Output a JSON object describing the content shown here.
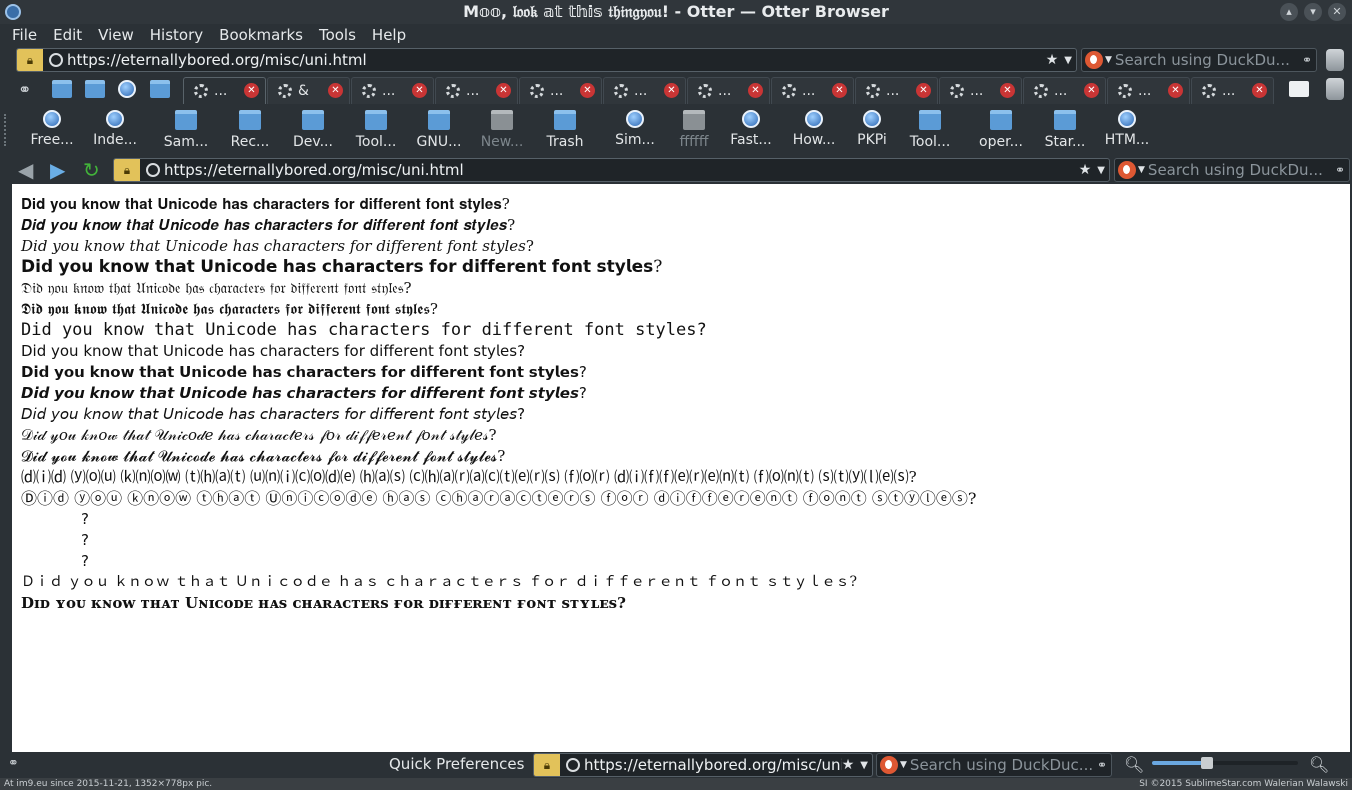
{
  "window": {
    "title": "M𝕠𝕠, 𝔩𝔬𝔬𝔨 𝕒𝕥 𝕥𝕙𝕚𝕤 𝔱𝔥𝔦𝔫𝔤𝔶𝔬𝔲! - Otter — Otter Browser",
    "controls": [
      "▴",
      "▾",
      "✕"
    ]
  },
  "menu": [
    "File",
    "Edit",
    "View",
    "History",
    "Bookmarks",
    "Tools",
    "Help"
  ],
  "address": {
    "url": "https://eternallybored.org/misc/uni.html"
  },
  "search": {
    "placeholder": "Search using DuckDu..."
  },
  "tabs": [
    {
      "label": "...",
      "active": true
    },
    {
      "label": "&"
    },
    {
      "label": "..."
    },
    {
      "label": "..."
    },
    {
      "label": "..."
    },
    {
      "label": "..."
    },
    {
      "label": "..."
    },
    {
      "label": "..."
    },
    {
      "label": "..."
    },
    {
      "label": "..."
    },
    {
      "label": "..."
    },
    {
      "label": "..."
    },
    {
      "label": "..."
    }
  ],
  "bookmarks": [
    {
      "label": "Free...",
      "icon": "web-icon"
    },
    {
      "label": "Inde...",
      "icon": "web-icon"
    },
    {
      "label": "Sam...",
      "icon": "folder-icon"
    },
    {
      "label": "Rec...",
      "icon": "folder-icon"
    },
    {
      "label": "Dev...",
      "icon": "folder-icon"
    },
    {
      "label": "Tool...",
      "icon": "folder-icon"
    },
    {
      "label": "GNU...",
      "icon": "folder-icon"
    },
    {
      "label": "New...",
      "icon": "folder-grey-icon"
    },
    {
      "label": "Trash",
      "icon": "folder-icon"
    },
    {
      "label": "Sim...",
      "icon": "web-icon"
    },
    {
      "label": "ffffff",
      "icon": "folder-grey-icon"
    },
    {
      "label": "Fast...",
      "icon": "web-icon"
    },
    {
      "label": "How...",
      "icon": "web-icon"
    },
    {
      "label": "PKPi",
      "icon": "web-icon"
    },
    {
      "label": "Tool...",
      "icon": "folder-icon"
    },
    {
      "label": "oper...",
      "icon": "folder-icon"
    },
    {
      "label": "Star...",
      "icon": "folder-icon"
    },
    {
      "label": "HTM...",
      "icon": "web-icon"
    }
  ],
  "page": {
    "lines": [
      "𝐃𝐢𝐝 𝐲𝐨𝐮 𝐤𝐧𝐨𝐰 𝐭𝐡𝐚𝐭 𝐔𝐧𝐢𝐜𝐨𝐝𝐞 𝐡𝐚𝐬 𝐜𝐡𝐚𝐫𝐚𝐜𝐭𝐞𝐫𝐬 𝐟𝐨𝐫 𝐝𝐢𝐟𝐟𝐞𝐫𝐞𝐧𝐭 𝐟𝐨𝐧𝐭 𝐬𝐭𝐲𝐥𝐞𝐬?",
      "𝑫𝒊𝒅 𝒚𝒐𝒖 𝒌𝒏𝒐𝒘 𝒕𝒉𝒂𝒕 𝑼𝒏𝒊𝒄𝒐𝒅𝒆 𝒉𝒂𝒔 𝒄𝒉𝒂𝒓𝒂𝒄𝒕𝒆𝒓𝒔 𝒇𝒐𝒓 𝒅𝒊𝒇𝒇𝒆𝒓𝒆𝒏𝒕 𝒇𝒐𝒏𝒕 𝒔𝒕𝒚𝒍𝒆𝒔?",
      "𝐷𝑖𝑑 𝑦𝑜𝑢 𝑘𝑛𝑜𝑤 𝑡ℎ𝑎𝑡 𝑈𝑛𝑖𝑐𝑜𝑑𝑒 ℎ𝑎𝑠 𝑐ℎ𝑎𝑟𝑎𝑐𝑡𝑒𝑟𝑠 𝑓𝑜𝑟 𝑑𝑖𝑓𝑓𝑒𝑟𝑒𝑛𝑡 𝑓𝑜𝑛𝑡 𝑠𝑡𝑦𝑙𝑒𝑠?",
      "𝗗𝗶𝗱 𝘆𝗼𝘂 𝗸𝗻𝗼𝘄 𝘁𝗵𝗮𝘁 𝗨𝗻𝗶𝗰𝗼𝗱𝗲 𝗵𝗮𝘀 𝗰𝗵𝗮𝗿𝗮𝗰𝘁𝗲𝗿𝘀 𝗳𝗼𝗿 𝗱𝗶𝗳𝗳𝗲𝗿𝗲𝗻𝘁 𝗳𝗼𝗻𝘁 𝘀𝘁𝘆𝗹𝗲𝘀?",
      "𝔇𝔦𝔡 𝔶𝔬𝔲 𝔨𝔫𝔬𝔴 𝔱𝔥𝔞𝔱 𝔘𝔫𝔦𝔠𝔬𝔡𝔢 𝔥𝔞𝔰 𝔠𝔥𝔞𝔯𝔞𝔠𝔱𝔢𝔯𝔰 𝔣𝔬𝔯 𝔡𝔦𝔣𝔣𝔢𝔯𝔢𝔫𝔱 𝔣𝔬𝔫𝔱 𝔰𝔱𝔶𝔩𝔢𝔰?",
      "𝕯𝖎𝖉 𝖞𝖔𝖚 𝖐𝖓𝖔𝖜 𝖙𝖍𝖆𝖙 𝖀𝖓𝖎𝖈𝖔𝖉𝖊 𝖍𝖆𝖘 𝖈𝖍𝖆𝖗𝖆𝖈𝖙𝖊𝖗𝖘 𝖋𝖔𝖗 𝖉𝖎𝖋𝖋𝖊𝖗𝖊𝖓𝖙 𝖋𝖔𝖓𝖙 𝖘𝖙𝖞𝖑𝖊𝖘?",
      "𝙳𝚒𝚍 𝚢𝚘𝚞 𝚔𝚗𝚘𝚠 𝚝𝚑𝚊𝚝 𝚄𝚗𝚒𝚌𝚘𝚍𝚎 𝚑𝚊𝚜 𝚌𝚑𝚊𝚛𝚊𝚌𝚝𝚎𝚛𝚜 𝚏𝚘𝚛 𝚍𝚒𝚏𝚏𝚎𝚛𝚎𝚗𝚝 𝚏𝚘𝚗𝚝 𝚜𝚝𝚢𝚕𝚎𝚜?",
      "𝖣𝗂𝖽 𝗒𝗈𝗎 𝗄𝗇𝗈𝗐 𝗍𝗁𝖺𝗍 𝖴𝗇𝗂𝖼𝗈𝖽𝖾 𝗁𝖺𝗌 𝖼𝗁𝖺𝗋𝖺𝖼𝗍𝖾𝗋𝗌 𝖿𝗈𝗋 𝖽𝗂𝖿𝖿𝖾𝗋𝖾𝗇𝗍 𝖿𝗈𝗇𝗍 𝗌𝗍𝗒𝗅𝖾𝗌?",
      "𝗗𝗶𝗱 𝘆𝗼𝘂 𝗸𝗻𝗼𝘄 𝘁𝗵𝗮𝘁 𝗨𝗻𝗶𝗰𝗼𝗱𝗲 𝗵𝗮𝘀 𝗰𝗵𝗮𝗿𝗮𝗰𝘁𝗲𝗿𝘀 𝗳𝗼𝗿 𝗱𝗶𝗳𝗳𝗲𝗿𝗲𝗻𝘁 𝗳𝗼𝗻𝘁 𝘀𝘁𝘆𝗹𝗲𝘀?",
      "𝘿𝙞𝙙 𝙮𝙤𝙪 𝙠𝙣𝙤𝙬 𝙩𝙝𝙖𝙩 𝙐𝙣𝙞𝙘𝙤𝙙𝙚 𝙝𝙖𝙨 𝙘𝙝𝙖𝙧𝙖𝙘𝙩𝙚𝙧𝙨 𝙛𝙤𝙧 𝙙𝙞𝙛𝙛𝙚𝙧𝙚𝙣𝙩 𝙛𝙤𝙣𝙩 𝙨𝙩𝙮𝙡𝙚𝙨?",
      "𝘋𝘪𝘥 𝘺𝘰𝘶 𝘬𝘯𝘰𝘸 𝘵𝘩𝘢𝘵 𝘜𝘯𝘪𝘤𝘰𝘥𝘦 𝘩𝘢𝘴 𝘤𝘩𝘢𝘳𝘢𝘤𝘵𝘦𝘳𝘴 𝘧𝘰𝘳 𝘥𝘪𝘧𝘧𝘦𝘳𝘦𝘯𝘵 𝘧𝘰𝘯𝘵 𝘴𝘵𝘺𝘭𝘦𝘴?",
      "𝒟𝒾𝒹 𝓎𝑜𝓊 𝓀𝓃𝑜𝓌 𝓉𝒽𝒶𝓉 𝒰𝓃𝒾𝒸𝑜𝒹𝑒 𝒽𝒶𝓈 𝒸𝒽𝒶𝓇𝒶𝒸𝓉𝑒𝓇𝓈 𝒻𝑜𝓇 𝒹𝒾𝒻𝒻𝑒𝓇𝑒𝓃𝓉 𝒻𝑜𝓃𝓉 𝓈𝓉𝓎𝓁𝑒𝓈?",
      "𝓓𝓲𝓭 𝔂𝓸𝓾 𝓴𝓷𝓸𝔀 𝓽𝓱𝓪𝓽 𝓤𝓷𝓲𝓬𝓸𝓭𝓮 𝓱𝓪𝓼 𝓬𝓱𝓪𝓻𝓪𝓬𝓽𝓮𝓻𝓼 𝓯𝓸𝓻 𝓭𝓲𝓯𝓯𝓮𝓻𝓮𝓷𝓽 𝓯𝓸𝓷𝓽 𝓼𝓽𝔂𝓵𝓮𝓼?",
      "⒟⒤⒟ ⒴⒪⒰ ⒦⒩⒪⒲ ⒯⒣⒜⒯ ⒰⒩⒤⒞⒪⒟⒠ ⒣⒜⒮ ⒞⒣⒜⒭⒜⒞⒯⒠⒭⒮ ⒡⒪⒭ ⒟⒤⒡⒡⒠⒭⒠⒩⒯ ⒡⒪⒩⒯ ⒮⒯⒴⒧⒠⒮?",
      "Ⓓⓘⓓ ⓨⓞⓤ ⓚⓝⓞⓦ ⓣⓗⓐⓣ Ⓤⓝⓘⓒⓞⓓⓔ ⓗⓐⓢ ⓒⓗⓐⓡⓐⓒⓣⓔⓡⓢ ⓕⓞⓡ ⓓⓘⓕⓕⓔⓡⓔⓝⓣ ⓕⓞⓝⓣ ⓢⓣⓨⓛⓔⓢ?",
      "?",
      "?",
      "?",
      "Ｄｉｄ ｙｏｕ ｋｎｏｗ ｔｈａｔ Ｕｎｉｃｏｄｅ ｈａｓ ｃｈａｒａｃｔｅｒｓ ｆｏｒ ｄｉｆｆｅｒｅｎｔ ｆｏｎｔ ｓｔｙｌｅｓ?",
      "Dɪᴅ ʏᴏᴜ ᴋɴᴏᴡ ᴛʜᴀᴛ Uɴɪᴄᴏᴅᴇ ʜᴀs ᴄʜᴀʀᴀᴄᴛᴇʀs ғᴏʀ ᴅɪғғᴇʀᴇɴᴛ ғᴏɴᴛ sᴛʏʟᴇs?"
    ]
  },
  "status": {
    "quick_prefs": "Quick Preferences",
    "url": "https://eternallybored.org/misc/uni",
    "search_placeholder": "Search using DuckDuc...",
    "zoom_fraction": 0.38
  },
  "footer": {
    "left": "At im9.eu since 2015-11-21, 1352×778px pic.",
    "right": "SI ©2015 SublimeStar.com Walerian Walawski"
  },
  "colors": {
    "lock": "#e2c25a",
    "close": "#c93535",
    "link_blue": "#5b9bd6"
  }
}
